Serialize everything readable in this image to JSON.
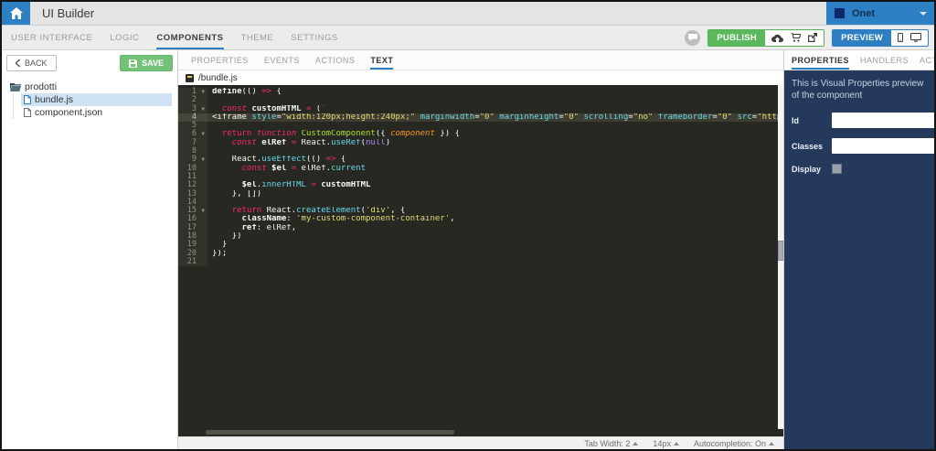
{
  "colors": {
    "accent_blue": "#2d7fc2",
    "publish_green": "#5cb85c",
    "save_green": "#74c277",
    "panel_navy": "#24395b",
    "editor_bg": "#272822",
    "keyword_pink": "#f92672",
    "string_yellow": "#e6db74",
    "method_cyan": "#66d9ef",
    "function_green": "#a6e22e"
  },
  "header": {
    "title": "UI Builder",
    "home_icon": "home-icon",
    "app_selector": {
      "label": "Onet",
      "icon": "app-logo-icon",
      "caret": "chevron-down-icon"
    }
  },
  "toolbar": {
    "nav_tabs": [
      {
        "label": "USER INTERFACE",
        "active": false
      },
      {
        "label": "LOGIC",
        "active": false
      },
      {
        "label": "COMPONENTS",
        "active": true
      },
      {
        "label": "THEME",
        "active": false
      },
      {
        "label": "SETTINGS",
        "active": false
      }
    ],
    "chat_icon": "chat-bubble-icon",
    "publish": {
      "label": "PUBLISH",
      "icons": [
        "cloud-upload-icon",
        "cart-icon",
        "export-icon"
      ]
    },
    "preview": {
      "label": "PREVIEW",
      "icons": [
        "phone-icon",
        "monitor-icon"
      ]
    }
  },
  "sidebar": {
    "back_label": "BACK",
    "save_label": "SAVE",
    "tree": [
      {
        "label": "prodotti",
        "type": "folder",
        "selected": false
      },
      {
        "label": "bundle.js",
        "type": "file",
        "selected": true,
        "child": true
      },
      {
        "label": "component.json",
        "type": "file",
        "selected": false,
        "child": true
      }
    ]
  },
  "editor": {
    "tabs": [
      {
        "label": "PROPERTIES",
        "active": false
      },
      {
        "label": "EVENTS",
        "active": false
      },
      {
        "label": "ACTIONS",
        "active": false
      },
      {
        "label": "TEXT",
        "active": true
      }
    ],
    "filename": "/bundle.js",
    "active_line": 4,
    "fold_lines": [
      1,
      3,
      6,
      9,
      15
    ],
    "line_count": 21,
    "lines": {
      "1": [
        {
          "c": "b",
          "t": "define"
        },
        {
          "c": "d",
          "t": "(() "
        },
        {
          "c": "k",
          "t": "=>"
        },
        {
          "c": "d",
          "t": " {"
        }
      ],
      "2": [],
      "3": [
        {
          "c": "d",
          "t": "  "
        },
        {
          "c": "ki",
          "t": "const"
        },
        {
          "c": "b",
          "t": " customHTML "
        },
        {
          "c": "k",
          "t": "="
        },
        {
          "c": "d",
          "t": " (`"
        }
      ],
      "4": [
        {
          "c": "d",
          "t": "<iframe "
        },
        {
          "c": "a",
          "t": "style"
        },
        {
          "c": "d",
          "t": "="
        },
        {
          "c": "s",
          "t": "\"width:120px;height:240px;\""
        },
        {
          "c": "d",
          "t": " "
        },
        {
          "c": "a",
          "t": "marginwidth"
        },
        {
          "c": "d",
          "t": "="
        },
        {
          "c": "s",
          "t": "\"0\""
        },
        {
          "c": "d",
          "t": " "
        },
        {
          "c": "a",
          "t": "marginheight"
        },
        {
          "c": "d",
          "t": "="
        },
        {
          "c": "s",
          "t": "\"0\""
        },
        {
          "c": "d",
          "t": " "
        },
        {
          "c": "a",
          "t": "scrolling"
        },
        {
          "c": "d",
          "t": "="
        },
        {
          "c": "s",
          "t": "\"no\""
        },
        {
          "c": "d",
          "t": " "
        },
        {
          "c": "a",
          "t": "frameborder"
        },
        {
          "c": "d",
          "t": "="
        },
        {
          "c": "s",
          "t": "\"0\""
        },
        {
          "c": "d",
          "t": " "
        },
        {
          "c": "a",
          "t": "src"
        },
        {
          "c": "d",
          "t": "="
        },
        {
          "c": "s",
          "t": "\"https://rcm-eu.amazon-adsystem.com/e/"
        }
      ],
      "5": [],
      "6": [
        {
          "c": "d",
          "t": "  "
        },
        {
          "c": "k",
          "t": "return"
        },
        {
          "c": "d",
          "t": " "
        },
        {
          "c": "ki",
          "t": "function"
        },
        {
          "c": "d",
          "t": " "
        },
        {
          "c": "f",
          "t": "CustomComponent"
        },
        {
          "c": "d",
          "t": "({ "
        },
        {
          "c": "p",
          "t": "component"
        },
        {
          "c": "d",
          "t": " }) {"
        }
      ],
      "7": [
        {
          "c": "d",
          "t": "    "
        },
        {
          "c": "ki",
          "t": "const"
        },
        {
          "c": "b",
          "t": " elRef "
        },
        {
          "c": "k",
          "t": "="
        },
        {
          "c": "d",
          "t": " React."
        },
        {
          "c": "m",
          "t": "useRef"
        },
        {
          "c": "d",
          "t": "("
        },
        {
          "c": "n",
          "t": "null"
        },
        {
          "c": "d",
          "t": ")"
        }
      ],
      "8": [],
      "9": [
        {
          "c": "d",
          "t": "    React."
        },
        {
          "c": "m",
          "t": "useEffect"
        },
        {
          "c": "d",
          "t": "(() "
        },
        {
          "c": "k",
          "t": "=>"
        },
        {
          "c": "d",
          "t": " {"
        }
      ],
      "10": [
        {
          "c": "d",
          "t": "      "
        },
        {
          "c": "ki",
          "t": "const"
        },
        {
          "c": "b",
          "t": " $el "
        },
        {
          "c": "k",
          "t": "="
        },
        {
          "c": "d",
          "t": " elRef."
        },
        {
          "c": "m",
          "t": "current"
        }
      ],
      "11": [],
      "12": [
        {
          "c": "d",
          "t": "      "
        },
        {
          "c": "b",
          "t": "$el"
        },
        {
          "c": "d",
          "t": "."
        },
        {
          "c": "m",
          "t": "innerHTML"
        },
        {
          "c": "d",
          "t": " "
        },
        {
          "c": "k",
          "t": "="
        },
        {
          "c": "b",
          "t": " customHTML"
        }
      ],
      "13": [
        {
          "c": "d",
          "t": "    }, [])"
        }
      ],
      "14": [],
      "15": [
        {
          "c": "d",
          "t": "    "
        },
        {
          "c": "k",
          "t": "return"
        },
        {
          "c": "d",
          "t": " React."
        },
        {
          "c": "m",
          "t": "createElement"
        },
        {
          "c": "d",
          "t": "("
        },
        {
          "c": "s",
          "t": "'div'"
        },
        {
          "c": "d",
          "t": ", {"
        }
      ],
      "16": [
        {
          "c": "d",
          "t": "      "
        },
        {
          "c": "b",
          "t": "className"
        },
        {
          "c": "d",
          "t": ": "
        },
        {
          "c": "s",
          "t": "'my-custom-component-container'"
        },
        {
          "c": "d",
          "t": ","
        }
      ],
      "17": [
        {
          "c": "d",
          "t": "      "
        },
        {
          "c": "b",
          "t": "ref"
        },
        {
          "c": "d",
          "t": ": elRef,"
        }
      ],
      "18": [
        {
          "c": "d",
          "t": "    })"
        }
      ],
      "19": [
        {
          "c": "d",
          "t": "  }"
        }
      ],
      "20": [
        {
          "c": "d",
          "t": "});"
        }
      ],
      "21": []
    },
    "status_items": [
      "Tab Width: 2",
      "14px",
      "Autocompletion: On"
    ]
  },
  "properties_panel": {
    "tabs": [
      {
        "label": "PROPERTIES",
        "active": true
      },
      {
        "label": "HANDLERS",
        "active": false
      },
      {
        "label": "ACTIONS",
        "active": false
      }
    ],
    "description": "This is Visual Properties preview of the component",
    "fields": [
      {
        "label": "Id",
        "type": "text",
        "value": ""
      },
      {
        "label": "Classes",
        "type": "text",
        "value": ""
      },
      {
        "label": "Display",
        "type": "checkbox",
        "checked": false
      }
    ]
  }
}
